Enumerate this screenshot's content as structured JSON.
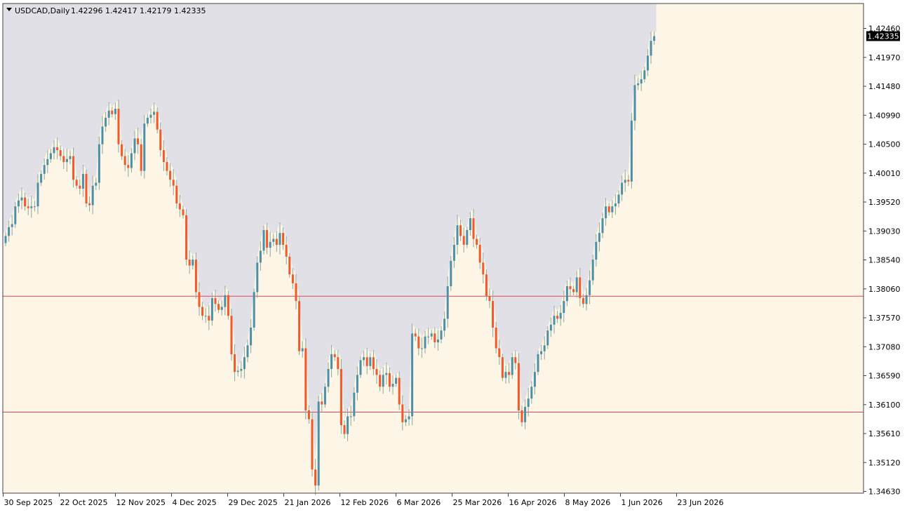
{
  "header": {
    "symbol_label": "USDCAD,Daily",
    "ohlc_label": "1.42296 1.42417 1.42179 1.42335"
  },
  "price_axis": {
    "ticks": [
      "1.42460",
      "1.41970",
      "1.41480",
      "1.40990",
      "1.40500",
      "1.40010",
      "1.39520",
      "1.39030",
      "1.38540",
      "1.38060",
      "1.37570",
      "1.37080",
      "1.36590",
      "1.36100",
      "1.35610",
      "1.35120",
      "1.34630"
    ],
    "current_price_label": "1.42335"
  },
  "time_axis": {
    "labels": [
      "30 Sep 2025",
      "22 Oct 2025",
      "12 Nov 2025",
      "4 Dec 2025",
      "29 Dec 2025",
      "21 Jan 2026",
      "12 Feb 2026",
      "6 Mar 2026",
      "25 Mar 2026",
      "16 Apr 2026",
      "8 May 2026",
      "1 Jun 2026",
      "23 Jun 2026"
    ]
  },
  "colors": {
    "background": "#fdf5e6",
    "shaded_region": "#e1e0e6",
    "bull": "#4b8fa8",
    "bear": "#f2582a",
    "wick": "#88a89c",
    "hline": "#e0455a",
    "axis": "#444444",
    "price_tag_bg": "#000000",
    "price_tag_text": "#ffffff"
  },
  "chart_data": {
    "type": "candlestick",
    "symbol": "USDCAD",
    "timeframe": "Daily",
    "ylim": [
      1.3463,
      1.427
    ],
    "horizontal_lines": [
      1.3793,
      1.3597
    ],
    "shaded_region_note": "range above price series, up to the last bar",
    "closes": [
      1.3895,
      1.391,
      1.3915,
      1.3945,
      1.3955,
      1.396,
      1.3945,
      1.3942,
      1.3945,
      1.3945,
      1.3985,
      1.4,
      1.4015,
      1.4025,
      1.4035,
      1.4045,
      1.404,
      1.403,
      1.402,
      1.4025,
      1.403,
      1.399,
      1.398,
      1.3975,
      1.4,
      1.395,
      1.3947,
      1.398,
      1.3985,
      1.405,
      1.408,
      1.4095,
      1.4107,
      1.4101,
      1.411,
      1.405,
      1.403,
      1.4015,
      1.401,
      1.4035,
      1.406,
      1.405,
      1.4005,
      1.4085,
      1.4095,
      1.41,
      1.4105,
      1.4075,
      1.404,
      1.402,
      1.4005,
      1.399,
      1.398,
      1.395,
      1.394,
      1.393,
      1.3855,
      1.3845,
      1.3855,
      1.38,
      1.3775,
      1.376,
      1.376,
      1.3752,
      1.379,
      1.378,
      1.377,
      1.3775,
      1.3795,
      1.376,
      1.3695,
      1.3665,
      1.3667,
      1.367,
      1.369,
      1.371,
      1.374,
      1.38,
      1.385,
      1.387,
      1.3905,
      1.3875,
      1.3885,
      1.389,
      1.388,
      1.39,
      1.388,
      1.386,
      1.383,
      1.3815,
      1.3785,
      1.37,
      1.3705,
      1.36,
      1.3585,
      1.35,
      1.3473,
      1.3615,
      1.361,
      1.364,
      1.367,
      1.3695,
      1.369,
      1.367,
      1.3575,
      1.356,
      1.359,
      1.359,
      1.363,
      1.366,
      1.3685,
      1.369,
      1.3675,
      1.369,
      1.367,
      1.366,
      1.364,
      1.366,
      1.3663,
      1.364,
      1.3645,
      1.3655,
      1.361,
      1.358,
      1.3585,
      1.359,
      1.373,
      1.3725,
      1.3705,
      1.3705,
      1.3725,
      1.3725,
      1.373,
      1.3715,
      1.372,
      1.3735,
      1.3755,
      1.381,
      1.3853,
      1.388,
      1.3913,
      1.3895,
      1.388,
      1.3905,
      1.3925,
      1.389,
      1.388,
      1.385,
      1.383,
      1.3793,
      1.3785,
      1.374,
      1.3705,
      1.369,
      1.3655,
      1.3665,
      1.366,
      1.369,
      1.368,
      1.36,
      1.358,
      1.3606,
      1.362,
      1.364,
      1.3665,
      1.3695,
      1.37,
      1.371,
      1.3735,
      1.3745,
      1.376,
      1.3755,
      1.3765,
      1.3785,
      1.381,
      1.3805,
      1.38,
      1.3825,
      1.379,
      1.378,
      1.3795,
      1.382,
      1.3855,
      1.3885,
      1.39,
      1.3925,
      1.3945,
      1.3935,
      1.3945,
      1.395,
      1.3965,
      1.3985,
      1.399,
      1.3987,
      1.409,
      1.415,
      1.4153,
      1.416,
      1.4175,
      1.42,
      1.4225,
      1.4233
    ]
  }
}
